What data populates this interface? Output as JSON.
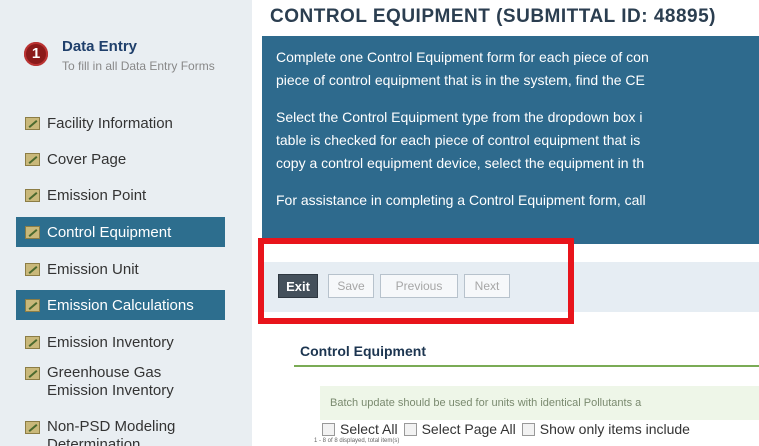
{
  "sidebar": {
    "step": {
      "number": "1",
      "title": "Data Entry",
      "subtitle": "To fill in all Data Entry Forms"
    },
    "items": [
      {
        "label": "Facility Information"
      },
      {
        "label": "Cover Page"
      },
      {
        "label": "Emission Point"
      },
      {
        "label": "Control Equipment",
        "active": true
      },
      {
        "label": "Emission Unit"
      },
      {
        "label": "Emission Calculations",
        "active": true
      },
      {
        "label": "Emission Inventory"
      },
      {
        "label": "Greenhouse Gas Emission Inventory"
      },
      {
        "label": "Non-PSD Modeling Determination"
      }
    ]
  },
  "main": {
    "title": "CONTROL EQUIPMENT (SUBMITTAL ID: 48895)",
    "info": {
      "p1_line1": "Complete one Control Equipment form for each piece of con",
      "p1_line2": "piece of control equipment that is in the system, find the CE",
      "p2_line1": "Select the Control Equipment type from the dropdown box i",
      "p2_line2": "table is checked for each piece of control equipment that is",
      "p2_line3": "copy a control equipment device, select the equipment in th",
      "p3_line1": "For assistance in completing a Control Equipment form, call"
    },
    "toolbar": {
      "exit": "Exit",
      "save": "Save",
      "previous": "Previous",
      "next": "Next"
    },
    "section_title": "Control Equipment",
    "batch_note": "Batch update should be used for units with identical Pollutants a",
    "select_all": "Select All",
    "select_page_all": "Select Page All",
    "show_only": "Show only items include",
    "tiny_text": "1 - 8 of 8 displayed, total item(s)"
  },
  "colors": {
    "accent": "#2d6e8e",
    "info_bg": "#2e6a8d",
    "highlight": "#e8141b",
    "step_badge": "#8b1a1a"
  }
}
